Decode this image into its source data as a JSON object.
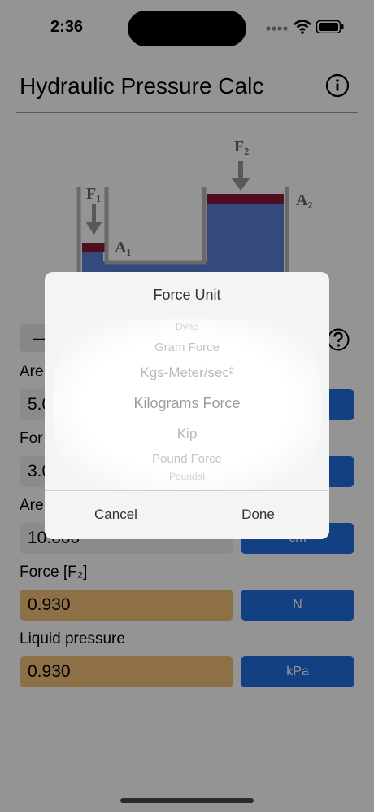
{
  "status": {
    "time": "2:36"
  },
  "header": {
    "title": "Hydraulic Pressure Calc"
  },
  "diagram": {
    "f1_label": "F₁",
    "f2_label": "F₂",
    "a1_label": "A₁",
    "a2_label": "A₂"
  },
  "controls": {
    "side_button_label": "—"
  },
  "form": {
    "area1": {
      "label": "Are",
      "value": "5.0"
    },
    "force1": {
      "label": "For",
      "value": "3.0"
    },
    "area2": {
      "label": "Are",
      "value": "10.000",
      "unit": "cm"
    },
    "force2": {
      "label": "Force [F₂]",
      "value": "0.930",
      "unit": "N"
    },
    "pressure": {
      "label": "Liquid pressure",
      "value": "0.930",
      "unit": "kPa"
    }
  },
  "modal": {
    "title": "Force Unit",
    "options": [
      "Dyne",
      "Gram Force",
      "Kgs-Meter/sec²",
      "Kilograms Force",
      "Kip",
      "Pound Force",
      "Poundal"
    ],
    "selected": "Kilograms Force",
    "cancel_label": "Cancel",
    "done_label": "Done"
  },
  "colors": {
    "accent": "#1f6fe0",
    "result_field": "#f5c27a",
    "liquid": "#5b7fd6",
    "piston": "#8b1a3a"
  }
}
